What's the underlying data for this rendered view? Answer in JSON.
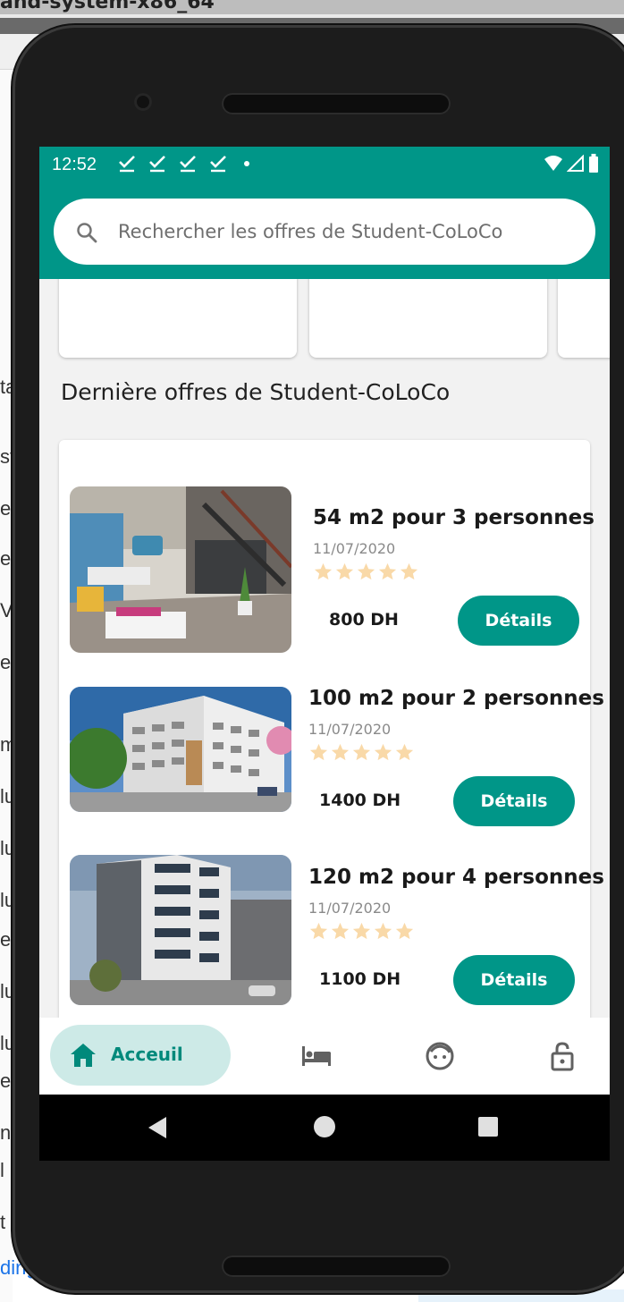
{
  "background_window": {
    "title_fragment": "and-system-x86_64",
    "link_fragment": "ding",
    "left_fragments": [
      "ta",
      "st",
      "et",
      "es",
      "Vr",
      "ea",
      "m",
      "lu",
      "lu",
      "lu",
      "e",
      "lu",
      "lu",
      "e",
      "nt",
      "l",
      "t"
    ]
  },
  "status_bar": {
    "time": "12:52",
    "notification_icons": [
      "check-icon",
      "check-icon",
      "check-icon",
      "check-icon",
      "dot-icon"
    ],
    "system_icons": [
      "wifi-icon",
      "signal-icon",
      "battery-icon"
    ]
  },
  "search": {
    "placeholder": "Rechercher les offres de Student-CoLoCo",
    "icon": "search-icon"
  },
  "section_title": "Dernière offres de Student-CoLoCo",
  "offers": [
    {
      "title": "54 m2 pour 3 personnes",
      "date": "11/07/2020",
      "rating": 5,
      "price": "800 DH",
      "button": "Détails",
      "image": "interior-loft-photo"
    },
    {
      "title": "100 m2 pour 2 personnes",
      "date": "11/07/2020",
      "rating": 5,
      "price": "1400 DH",
      "button": "Détails",
      "image": "apartment-building-photo"
    },
    {
      "title": "120 m2 pour 4 personnes",
      "date": "11/07/2020",
      "rating": 5,
      "price": "1100 DH",
      "button": "Détails",
      "image": "tower-building-photo"
    }
  ],
  "bottom_nav": {
    "active_label": "Acceuil",
    "items": [
      "home-icon",
      "bed-icon",
      "face-icon",
      "lock-icon"
    ]
  },
  "system_nav": [
    "back-icon",
    "home-circle-icon",
    "recents-icon"
  ],
  "colors": {
    "primary": "#009688",
    "nav_active_bg": "#cdeae7",
    "star": "#f9d9a8"
  }
}
